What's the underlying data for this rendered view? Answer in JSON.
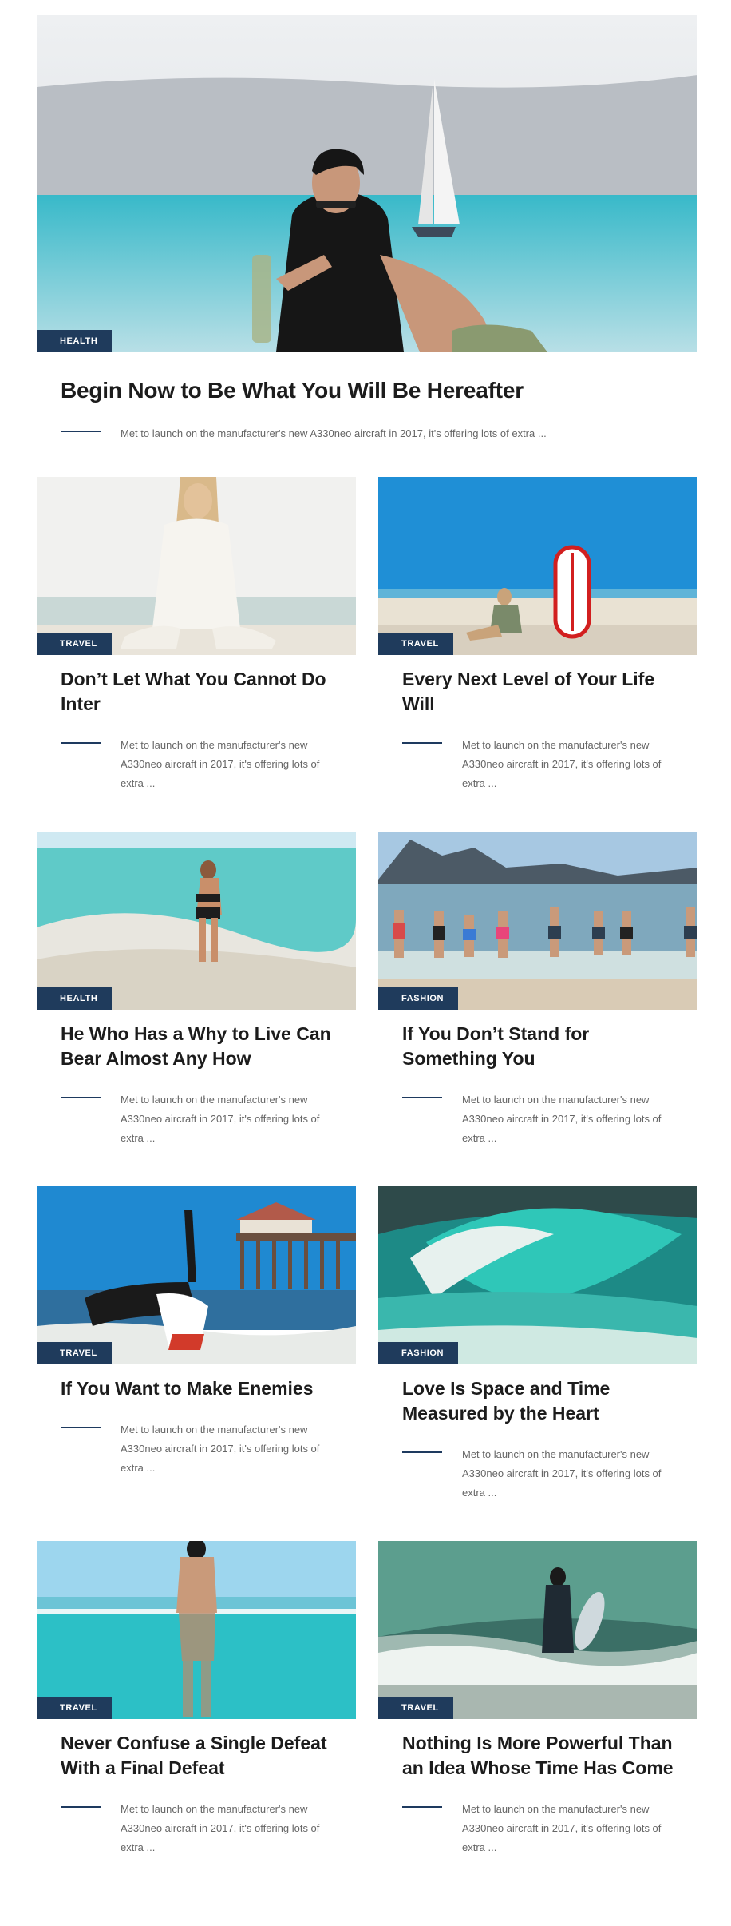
{
  "featured": {
    "category": "HEALTH",
    "title": "Begin Now to Be What You Will Be Hereafter",
    "excerpt": "Met to launch on the manufacturer's new A330neo aircraft in 2017, it's offering lots of extra ..."
  },
  "posts": [
    {
      "category": "TRAVEL",
      "title": "Don’t Let What You Cannot Do Inter",
      "excerpt": "Met to launch on the manufacturer's new A330neo aircraft in 2017, it's offering lots of extra ..."
    },
    {
      "category": "TRAVEL",
      "title": "Every Next Level of Your Life Will",
      "excerpt": "Met to launch on the manufacturer's new A330neo aircraft in 2017, it's offering lots of extra ..."
    },
    {
      "category": "HEALTH",
      "title": "He Who Has a Why to Live Can Bear Almost Any How",
      "excerpt": "Met to launch on the manufacturer's new A330neo aircraft in 2017, it's offering lots of extra ..."
    },
    {
      "category": "FASHION",
      "title": "If You Don’t Stand for Something You",
      "excerpt": "Met to launch on the manufacturer's new A330neo aircraft in 2017, it's offering lots of extra ..."
    },
    {
      "category": "TRAVEL",
      "title": "If You Want to Make Enemies",
      "excerpt": "Met to launch on the manufacturer's new A330neo aircraft in 2017, it's offering lots of extra ..."
    },
    {
      "category": "FASHION",
      "title": "Love Is Space and Time Measured by the Heart",
      "excerpt": "Met to launch on the manufacturer's new A330neo aircraft in 2017, it's offering lots of extra ..."
    },
    {
      "category": "TRAVEL",
      "title": "Never Confuse a Single Defeat With a Final Defeat",
      "excerpt": "Met to launch on the manufacturer's new A330neo aircraft in 2017, it's offering lots of extra ..."
    },
    {
      "category": "TRAVEL",
      "title": "Nothing Is More Powerful Than an Idea Whose Time Has Come",
      "excerpt": "Met to launch on the manufacturer's new A330neo aircraft in 2017, it's offering lots of extra ..."
    }
  ],
  "colors": {
    "accent": "#1f3b5c",
    "title": "#1c1c1c",
    "excerpt": "#666666"
  }
}
